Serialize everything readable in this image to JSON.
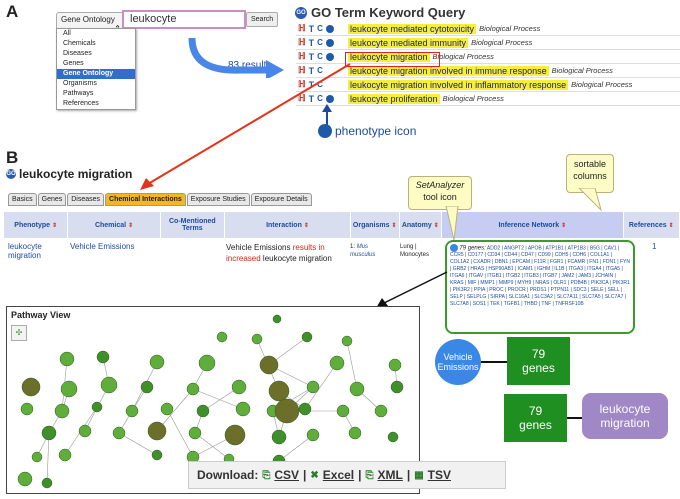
{
  "panel_a": {
    "letter": "A",
    "dropdown_value": "Gene Ontology",
    "search_value": "leukocyte",
    "search_button": "Search",
    "menu_items": [
      "All",
      "Chemicals",
      "Diseases",
      "Genes",
      "Gene Ontology",
      "Organisms",
      "Pathways",
      "References"
    ],
    "results_count": "83 results",
    "go_title": "GO Term Keyword Query",
    "go_badge": "GO",
    "results": [
      {
        "term": "leukocyte mediated cytotoxicity",
        "type": "Biological Process"
      },
      {
        "term": "leukocyte mediated immunity",
        "type": "Biological Process"
      },
      {
        "term": "leukocyte migration",
        "type": "Biological Process"
      },
      {
        "term": "leukocyte migration involved in immune response",
        "type": "Biological Process"
      },
      {
        "term": "leukocyte migration involved in inflammatory response",
        "type": "Biological Process"
      },
      {
        "term": "leukocyte proliferation",
        "type": "Biological Process"
      }
    ],
    "phenotype_icon_label": "phenotype icon"
  },
  "panel_b": {
    "letter": "B",
    "title": "leukocyte migration",
    "tabs": [
      "Basics",
      "Genes",
      "Diseases",
      "Chemical Interactions",
      "Exposure Studies",
      "Exposure Details"
    ],
    "columns": [
      "Phenotype",
      "Chemical",
      "Co-Mentioned Terms",
      "Interaction",
      "Organisms",
      "Anatomy",
      "Inference Network",
      "References"
    ],
    "row": {
      "phenotype": "leukocyte migration",
      "chemical": "Vehicle Emissions",
      "interaction_a": "Vehicle Emissions ",
      "interaction_red": "results in increased",
      "interaction_b": " leukocyte migration",
      "organism_num": "1:",
      "organism": "Mus musculus",
      "anatomy": "Lung | Monocytes",
      "genes_label": "79 genes:",
      "genes": "ADD2 | ANGPT2 | APOB | ATP1B1 | ATP1B3 | B5G | CAV1 | CCR5 | CD177 | CD34 | CD44 | CD47 | CD99 | CDH5 | CDH6 | COL1A1 | COL1A2 | CXADR | DBN1 | EPCAM | F11R | FGR1 | FCAMR | FN1 | FDN1 | FYN | GRB2 | HRAS | HSP90AB1 | ICAM1 | IGHM | IL1B | ITGA3 | ITGA4 | ITGA5 | ITGA6 | ITGAV | ITGB1 | ITGB2 | ITGB3 | ITGB7 | JAM2 | JAM3 | JCHAIN | KRAS | MIF | MMP1 | MMP9 | MYH9 | NRAS | OLR1 | PDB4B | PIK3CA | PIK3R1 | PIK3R2 | PPIA | PROC | PROCR | PRDS1 | PTPN11 | SDC3 | SELE | SELL | SELP | SELPLG | SIRPA | SLC16A1 | SLC3A2 | SLC7A11 | SLC7A5 | SLC7A7 | SLC7A8 | SOS1 | TEK | TGFB1 | THBD | TNF | TNFRSF10B",
      "references": "1"
    },
    "callout_setanalyzer_1": "SetAnalyzer",
    "callout_setanalyzer_2": "tool icon",
    "callout_sortable": "sortable columns"
  },
  "pathway": {
    "title": "Pathway View"
  },
  "network_summary": {
    "chemical": "Vehicle Emissions",
    "genes_count": "79",
    "genes_word": "genes",
    "phenotype": "leukocyte migration"
  },
  "download": {
    "label": "Download:",
    "csv": "CSV",
    "excel": "Excel",
    "xml": "XML",
    "tsv": "TSV"
  },
  "colors": {
    "highlight": "#f5ee3a",
    "active_tab": "#f3b724",
    "green": "#1f8f22",
    "blue": "#3b87e6",
    "purple": "#a087c6",
    "arrow_blue": "#4a86e8",
    "arrow_red": "#e0351b"
  }
}
